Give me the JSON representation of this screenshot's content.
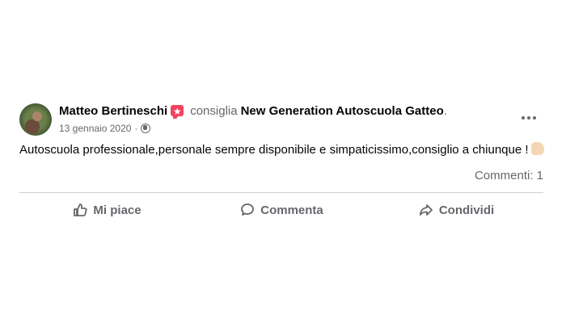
{
  "post": {
    "author": "Matteo Bertineschi",
    "verb": "consiglia",
    "page_name": "New Generation Autoscuola Gatteo",
    "period": ".",
    "date": "13 gennaio 2020",
    "separator": "·",
    "text": "Autoscuola professionale,personale sempre disponibile e simpaticissimo,consiglio a chiunque !",
    "comments": "Commenti: 1"
  },
  "actions": [
    {
      "label": "Mi piace"
    },
    {
      "label": "Commenta"
    },
    {
      "label": "Condividi"
    }
  ],
  "icons": {
    "badge": "recommendation-star-icon",
    "privacy": "globe-icon",
    "more": "more-options-icon",
    "emoji": "flexed-biceps-emoji",
    "like": "thumbs-up-icon",
    "comment": "comment-icon",
    "share": "share-icon"
  },
  "colors": {
    "badge": "#f3425f",
    "secondary_text": "#65676b",
    "primary_text": "#050505",
    "divider": "#ced0d4"
  }
}
